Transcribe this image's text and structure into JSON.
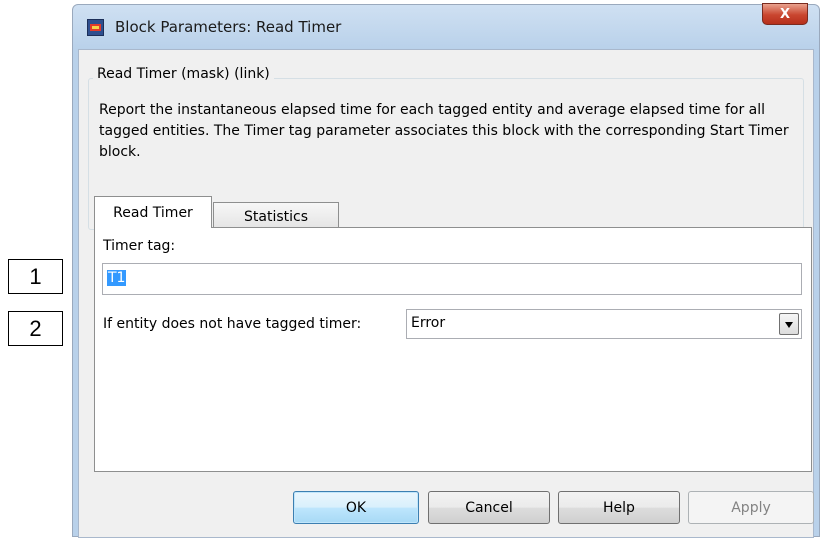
{
  "annotations": [
    "1",
    "2"
  ],
  "window": {
    "title": "Block Parameters: Read Timer",
    "close_label": "X"
  },
  "group": {
    "title": "Read Timer (mask) (link)",
    "description": "Report the instantaneous elapsed time for each tagged entity and average elapsed time for all tagged entities. The Timer tag parameter associates this block with the corresponding Start Timer block."
  },
  "tabs": [
    {
      "label": "Read Timer",
      "active": true
    },
    {
      "label": "Statistics",
      "active": false
    }
  ],
  "form": {
    "timer_tag_label": "Timer tag:",
    "timer_tag_value": "T1",
    "entity_label": "If entity does not have tagged timer:",
    "entity_value": "Error"
  },
  "buttons": {
    "ok": "OK",
    "cancel": "Cancel",
    "help": "Help",
    "apply": "Apply"
  },
  "colors": {
    "title_bar": "#b9d1ea",
    "selection": "#3399ff",
    "close_button": "#c9452f"
  }
}
